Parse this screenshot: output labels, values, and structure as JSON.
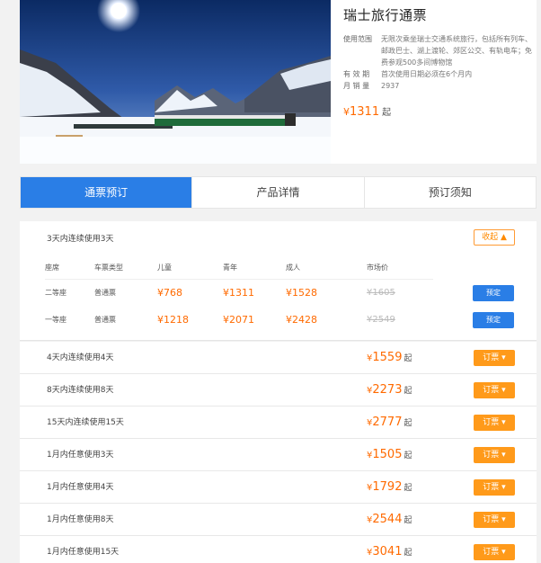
{
  "product": {
    "title": "瑞士旅行通票",
    "scope_label": "使用范围",
    "scope_value": "无限次乘坐瑞士交通系统旅行，包括所有列车、邮政巴士、湖上渡轮、郊区公交、有轨电车；免费参观500多间博物馆",
    "validity_label": "有 效 期",
    "validity_value": "首次使用日期必须在6个月内",
    "sales_label": "月 销 量",
    "sales_value": "2937",
    "price_yen": "¥",
    "price": "1311",
    "price_suffix": "起"
  },
  "tabs": [
    {
      "label": "通票预订",
      "active": true
    },
    {
      "label": "产品详情",
      "active": false
    },
    {
      "label": "预订须知",
      "active": false
    }
  ],
  "expanded": {
    "name": "3天内连续使用3天",
    "collapse_label": "收起 ▲",
    "headers": [
      "座席",
      "车票类型",
      "儿童",
      "青年",
      "成人",
      "市场价"
    ],
    "rows": [
      {
        "seat": "二等座",
        "type": "普通票",
        "child": "¥768",
        "youth": "¥1311",
        "adult": "¥1528",
        "market": "¥1605",
        "book": "预定"
      },
      {
        "seat": "一等座",
        "type": "普通票",
        "child": "¥1218",
        "youth": "¥2071",
        "adult": "¥2428",
        "market": "¥2549",
        "book": "预定"
      }
    ]
  },
  "passes": [
    {
      "name": "4天内连续使用4天",
      "price": "1559",
      "yen": "¥",
      "suffix": "起",
      "btn": "订票 ▾"
    },
    {
      "name": "8天内连续使用8天",
      "price": "2273",
      "yen": "¥",
      "suffix": "起",
      "btn": "订票 ▾"
    },
    {
      "name": "15天内连续使用15天",
      "price": "2777",
      "yen": "¥",
      "suffix": "起",
      "btn": "订票 ▾"
    },
    {
      "name": "1月内任意使用3天",
      "price": "1505",
      "yen": "¥",
      "suffix": "起",
      "btn": "订票 ▾"
    },
    {
      "name": "1月内任意使用4天",
      "price": "1792",
      "yen": "¥",
      "suffix": "起",
      "btn": "订票 ▾"
    },
    {
      "name": "1月内任意使用8天",
      "price": "2544",
      "yen": "¥",
      "suffix": "起",
      "btn": "订票 ▾"
    },
    {
      "name": "1月内任意使用15天",
      "price": "3041",
      "yen": "¥",
      "suffix": "起",
      "btn": "订票 ▾"
    }
  ],
  "colors": {
    "accent_blue": "#2a7ee6",
    "price_orange": "#ff6a00",
    "button_orange": "#ff9a1a"
  }
}
